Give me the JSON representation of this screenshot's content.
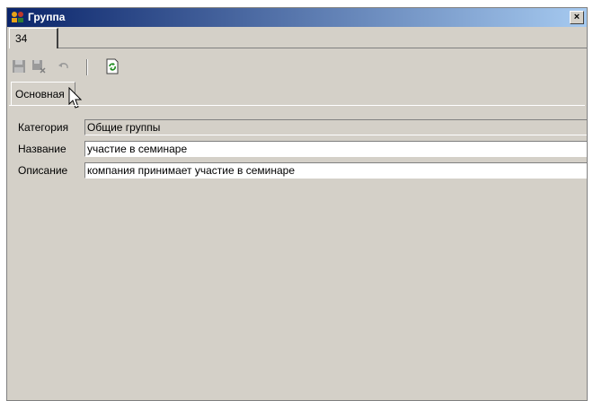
{
  "window": {
    "title": "Группа",
    "close_label": "×"
  },
  "record_tab": {
    "label": "34"
  },
  "toolbar": {
    "buttons": [
      "save-icon",
      "delete-icon",
      "undo-icon",
      "refresh-icon"
    ]
  },
  "section_tab": {
    "label": "Основная"
  },
  "form": {
    "category_label": "Категория",
    "category_value": "Общие группы",
    "name_label": "Название",
    "name_value": "участие в семинаре",
    "description_label": "Описание",
    "description_value": "компания принимает участие в семинаре"
  },
  "colors": {
    "titlebar_start": "#0a246a",
    "titlebar_end": "#a6caf0",
    "window_bg": "#d4d0c8"
  }
}
